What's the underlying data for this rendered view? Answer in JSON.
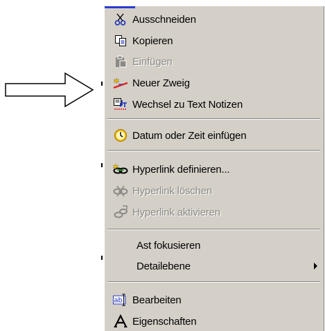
{
  "context_menu": {
    "items": [
      {
        "label": "Ausschneiden",
        "icon": "scissors-icon",
        "enabled": true
      },
      {
        "label": "Kopieren",
        "icon": "copy-icon",
        "enabled": true
      },
      {
        "label": "Einfügen",
        "icon": "paste-icon",
        "enabled": false
      },
      {
        "label": "Neuer Zweig",
        "icon": "new-branch-icon",
        "enabled": true
      },
      {
        "label": "Wechsel zu Text Notizen",
        "icon": "switch-to-notes-icon",
        "enabled": true
      },
      {
        "label": "Datum oder Zeit einfügen",
        "icon": "clock-icon",
        "enabled": true
      },
      {
        "label": "Hyperlink definieren...",
        "icon": "link-icon",
        "enabled": true
      },
      {
        "label": "Hyperlink löschen",
        "icon": "link-delete-icon",
        "enabled": false
      },
      {
        "label": "Hyperlink aktivieren",
        "icon": "link-activate-icon",
        "enabled": false
      },
      {
        "label": "Ast fokusieren",
        "icon": null,
        "enabled": true
      },
      {
        "label": "Detailebene",
        "icon": null,
        "enabled": true,
        "submenu": true
      },
      {
        "label": "Bearbeiten",
        "icon": "edit-text-icon",
        "enabled": true
      },
      {
        "label": "Eigenschaften",
        "icon": "properties-font-icon",
        "enabled": true
      }
    ]
  },
  "colors": {
    "menu_background": "#d4d0c8",
    "disabled_text": "#8c8a86",
    "highlight_edge": "#2a3ad0"
  }
}
